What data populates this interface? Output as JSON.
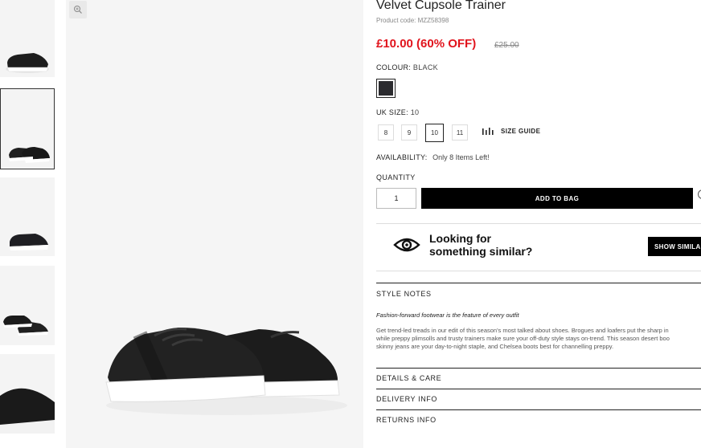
{
  "product": {
    "title": "Velvet Cupsole Trainer",
    "code": "Product code: MZZ58398",
    "price_now": "£10.00 (60% OFF)",
    "price_was": "£25.00",
    "colour_label": "COLOUR:",
    "colour_value": "BLACK",
    "swatch_color": "#2b2b2f",
    "size_label": "UK SIZE:",
    "size_value": "10",
    "sizes": [
      "8",
      "9",
      "10",
      "11"
    ],
    "selected_size": "10",
    "size_guide": "SIZE GUIDE",
    "availability_label": "AVAILABILITY:",
    "availability_value": "Only 8 Items Left!",
    "quantity_label": "QUANTITY",
    "quantity_value": "1",
    "add_to_bag": "ADD TO BAG"
  },
  "similar": {
    "line1": "Looking for",
    "line2": "something similar?",
    "button": "SHOW SIMILAR"
  },
  "style_notes": {
    "heading": "STYLE NOTES",
    "tagline": "Fashion-forward footwear is the feature of every outfit",
    "lines": [
      "Get trend-led treads in our edit of this season's most talked about shoes. Brogues and loafers put the sharp in",
      "while preppy plimsolls and trusty trainers make sure your off-duty style stays on-trend. This season desert boo",
      "skinny jeans are your day-to-night staple, and Chelsea boots best for channelling preppy."
    ]
  },
  "sections": {
    "details": "DETAILS & CARE",
    "delivery": "DELIVERY INFO",
    "returns": "RETURNS INFO"
  },
  "colors": {
    "sale_red": "#e1141d",
    "button_black": "#000000"
  },
  "icons": {
    "zoom": "magnifier-plus-icon",
    "size_guide": "ruler-icon",
    "similar": "eye-icon",
    "wishlist": "heart-icon"
  }
}
